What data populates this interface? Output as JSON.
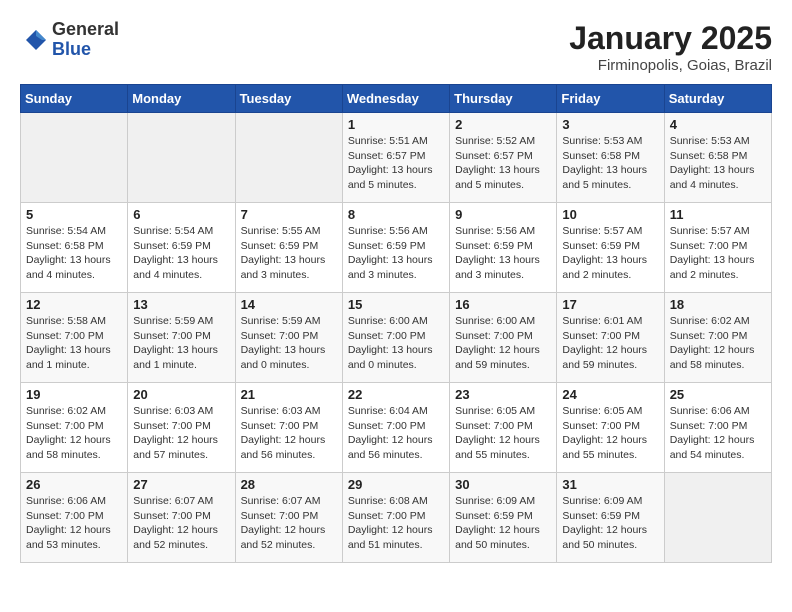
{
  "header": {
    "logo_general": "General",
    "logo_blue": "Blue",
    "title": "January 2025",
    "subtitle": "Firminopolis, Goias, Brazil"
  },
  "days_of_week": [
    "Sunday",
    "Monday",
    "Tuesday",
    "Wednesday",
    "Thursday",
    "Friday",
    "Saturday"
  ],
  "weeks": [
    [
      {
        "day": "",
        "info": ""
      },
      {
        "day": "",
        "info": ""
      },
      {
        "day": "",
        "info": ""
      },
      {
        "day": "1",
        "info": "Sunrise: 5:51 AM\nSunset: 6:57 PM\nDaylight: 13 hours and 5 minutes."
      },
      {
        "day": "2",
        "info": "Sunrise: 5:52 AM\nSunset: 6:57 PM\nDaylight: 13 hours and 5 minutes."
      },
      {
        "day": "3",
        "info": "Sunrise: 5:53 AM\nSunset: 6:58 PM\nDaylight: 13 hours and 5 minutes."
      },
      {
        "day": "4",
        "info": "Sunrise: 5:53 AM\nSunset: 6:58 PM\nDaylight: 13 hours and 4 minutes."
      }
    ],
    [
      {
        "day": "5",
        "info": "Sunrise: 5:54 AM\nSunset: 6:58 PM\nDaylight: 13 hours and 4 minutes."
      },
      {
        "day": "6",
        "info": "Sunrise: 5:54 AM\nSunset: 6:59 PM\nDaylight: 13 hours and 4 minutes."
      },
      {
        "day": "7",
        "info": "Sunrise: 5:55 AM\nSunset: 6:59 PM\nDaylight: 13 hours and 3 minutes."
      },
      {
        "day": "8",
        "info": "Sunrise: 5:56 AM\nSunset: 6:59 PM\nDaylight: 13 hours and 3 minutes."
      },
      {
        "day": "9",
        "info": "Sunrise: 5:56 AM\nSunset: 6:59 PM\nDaylight: 13 hours and 3 minutes."
      },
      {
        "day": "10",
        "info": "Sunrise: 5:57 AM\nSunset: 6:59 PM\nDaylight: 13 hours and 2 minutes."
      },
      {
        "day": "11",
        "info": "Sunrise: 5:57 AM\nSunset: 7:00 PM\nDaylight: 13 hours and 2 minutes."
      }
    ],
    [
      {
        "day": "12",
        "info": "Sunrise: 5:58 AM\nSunset: 7:00 PM\nDaylight: 13 hours and 1 minute."
      },
      {
        "day": "13",
        "info": "Sunrise: 5:59 AM\nSunset: 7:00 PM\nDaylight: 13 hours and 1 minute."
      },
      {
        "day": "14",
        "info": "Sunrise: 5:59 AM\nSunset: 7:00 PM\nDaylight: 13 hours and 0 minutes."
      },
      {
        "day": "15",
        "info": "Sunrise: 6:00 AM\nSunset: 7:00 PM\nDaylight: 13 hours and 0 minutes."
      },
      {
        "day": "16",
        "info": "Sunrise: 6:00 AM\nSunset: 7:00 PM\nDaylight: 12 hours and 59 minutes."
      },
      {
        "day": "17",
        "info": "Sunrise: 6:01 AM\nSunset: 7:00 PM\nDaylight: 12 hours and 59 minutes."
      },
      {
        "day": "18",
        "info": "Sunrise: 6:02 AM\nSunset: 7:00 PM\nDaylight: 12 hours and 58 minutes."
      }
    ],
    [
      {
        "day": "19",
        "info": "Sunrise: 6:02 AM\nSunset: 7:00 PM\nDaylight: 12 hours and 58 minutes."
      },
      {
        "day": "20",
        "info": "Sunrise: 6:03 AM\nSunset: 7:00 PM\nDaylight: 12 hours and 57 minutes."
      },
      {
        "day": "21",
        "info": "Sunrise: 6:03 AM\nSunset: 7:00 PM\nDaylight: 12 hours and 56 minutes."
      },
      {
        "day": "22",
        "info": "Sunrise: 6:04 AM\nSunset: 7:00 PM\nDaylight: 12 hours and 56 minutes."
      },
      {
        "day": "23",
        "info": "Sunrise: 6:05 AM\nSunset: 7:00 PM\nDaylight: 12 hours and 55 minutes."
      },
      {
        "day": "24",
        "info": "Sunrise: 6:05 AM\nSunset: 7:00 PM\nDaylight: 12 hours and 55 minutes."
      },
      {
        "day": "25",
        "info": "Sunrise: 6:06 AM\nSunset: 7:00 PM\nDaylight: 12 hours and 54 minutes."
      }
    ],
    [
      {
        "day": "26",
        "info": "Sunrise: 6:06 AM\nSunset: 7:00 PM\nDaylight: 12 hours and 53 minutes."
      },
      {
        "day": "27",
        "info": "Sunrise: 6:07 AM\nSunset: 7:00 PM\nDaylight: 12 hours and 52 minutes."
      },
      {
        "day": "28",
        "info": "Sunrise: 6:07 AM\nSunset: 7:00 PM\nDaylight: 12 hours and 52 minutes."
      },
      {
        "day": "29",
        "info": "Sunrise: 6:08 AM\nSunset: 7:00 PM\nDaylight: 12 hours and 51 minutes."
      },
      {
        "day": "30",
        "info": "Sunrise: 6:09 AM\nSunset: 6:59 PM\nDaylight: 12 hours and 50 minutes."
      },
      {
        "day": "31",
        "info": "Sunrise: 6:09 AM\nSunset: 6:59 PM\nDaylight: 12 hours and 50 minutes."
      },
      {
        "day": "",
        "info": ""
      }
    ]
  ]
}
